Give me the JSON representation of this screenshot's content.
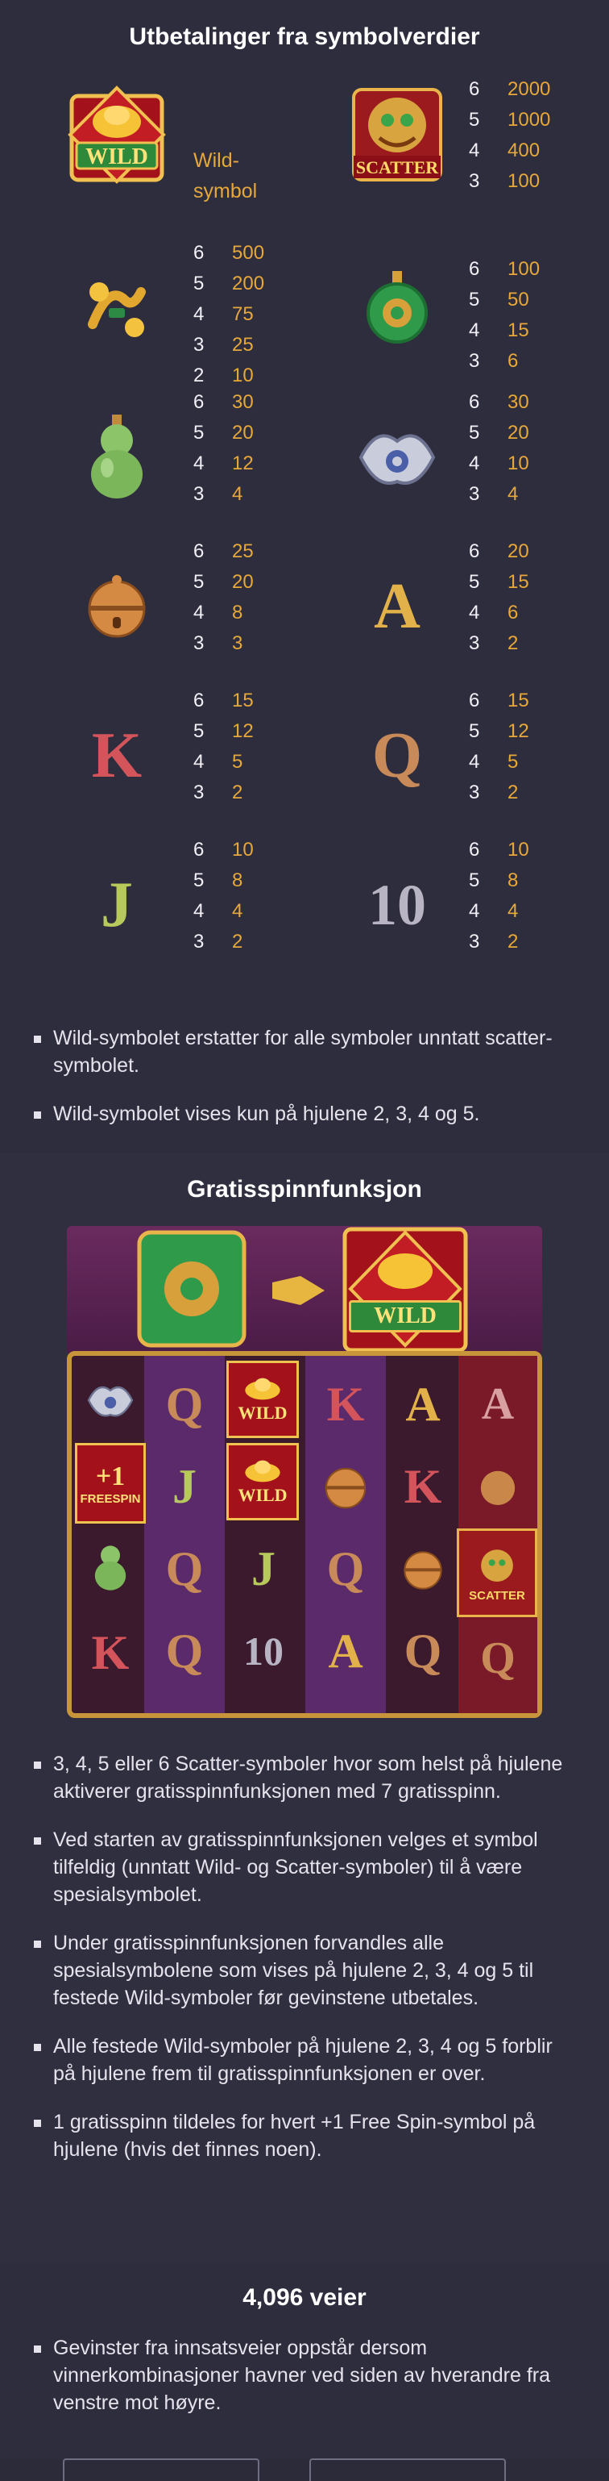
{
  "section1": {
    "title": "Utbetalinger fra symbolverdier",
    "wild_label": "Wild-\nsymbol",
    "wild_label_line1": "Wild-",
    "wild_label_line2": "symbol",
    "scatter_pays": [
      [
        "6",
        "2000"
      ],
      [
        "5",
        "1000"
      ],
      [
        "4",
        "400"
      ],
      [
        "3",
        "100"
      ]
    ],
    "symbols": [
      {
        "name": "ingot-ruyi",
        "pays": [
          [
            "6",
            "500"
          ],
          [
            "5",
            "200"
          ],
          [
            "4",
            "75"
          ],
          [
            "3",
            "25"
          ],
          [
            "2",
            "10"
          ]
        ]
      },
      {
        "name": "jade-pendant",
        "pays": [
          [
            "6",
            "100"
          ],
          [
            "5",
            "50"
          ],
          [
            "4",
            "15"
          ],
          [
            "3",
            "6"
          ]
        ]
      },
      {
        "name": "gourd",
        "pays": [
          [
            "6",
            "30"
          ],
          [
            "5",
            "20"
          ],
          [
            "4",
            "12"
          ],
          [
            "3",
            "4"
          ]
        ]
      },
      {
        "name": "silver-lock",
        "pays": [
          [
            "6",
            "30"
          ],
          [
            "5",
            "20"
          ],
          [
            "4",
            "10"
          ],
          [
            "3",
            "4"
          ]
        ]
      },
      {
        "name": "bell",
        "pays": [
          [
            "6",
            "25"
          ],
          [
            "5",
            "20"
          ],
          [
            "4",
            "8"
          ],
          [
            "3",
            "3"
          ]
        ]
      },
      {
        "name": "A",
        "pays": [
          [
            "6",
            "20"
          ],
          [
            "5",
            "15"
          ],
          [
            "4",
            "6"
          ],
          [
            "3",
            "2"
          ]
        ]
      },
      {
        "name": "K",
        "pays": [
          [
            "6",
            "15"
          ],
          [
            "5",
            "12"
          ],
          [
            "4",
            "5"
          ],
          [
            "3",
            "2"
          ]
        ]
      },
      {
        "name": "Q",
        "pays": [
          [
            "6",
            "15"
          ],
          [
            "5",
            "12"
          ],
          [
            "4",
            "5"
          ],
          [
            "3",
            "2"
          ]
        ]
      },
      {
        "name": "J",
        "pays": [
          [
            "6",
            "10"
          ],
          [
            "5",
            "8"
          ],
          [
            "4",
            "4"
          ],
          [
            "3",
            "2"
          ]
        ]
      },
      {
        "name": "10",
        "pays": [
          [
            "6",
            "10"
          ],
          [
            "5",
            "8"
          ],
          [
            "4",
            "4"
          ],
          [
            "3",
            "2"
          ]
        ]
      }
    ],
    "rules": [
      "Wild-symbolet erstatter for alle symboler unntatt scatter-symbolet.",
      "Wild-symbolet vises kun på hjulene 2, 3, 4 og 5."
    ]
  },
  "section2": {
    "title": "Gratisspinnfunksjon",
    "tile_wild": "WILD",
    "tile_scatter": "SCATTER",
    "tile_freespin_plus": "+1",
    "tile_freespin": "FREESPIN",
    "rules": [
      "3, 4, 5 eller 6 Scatter-symboler hvor som helst på hjulene aktiverer gratisspinnfunksjonen med 7 gratisspinn.",
      "Ved starten av gratisspinnfunksjonen velges et symbol tilfeldig (unntatt Wild- og Scatter-symboler) til å være spesialsymbolet.",
      "Under gratisspinnfunksjonen forvandles alle spesialsymbolene som vises på hjulene 2, 3, 4 og 5 til festede Wild-symboler før gevinstene utbetales.",
      "Alle festede Wild-symboler på hjulene 2, 3, 4 og 5 forblir på hjulene frem til gratisspinnfunksjonen er over.",
      "1 gratisspinn tildeles for hvert +1 Free Spin-symbol på hjulene (hvis det finnes noen)."
    ]
  },
  "section3": {
    "title": "4,096 veier",
    "rules": [
      "Gevinster fra innsatsveier oppstår dersom vinnerkombinasjoner havner ved siden av hverandre fra venstre mot høyre."
    ]
  },
  "colors": {
    "accent": "#e6a83a",
    "background": "#2e2d3d",
    "text": "#e6e3ec"
  }
}
